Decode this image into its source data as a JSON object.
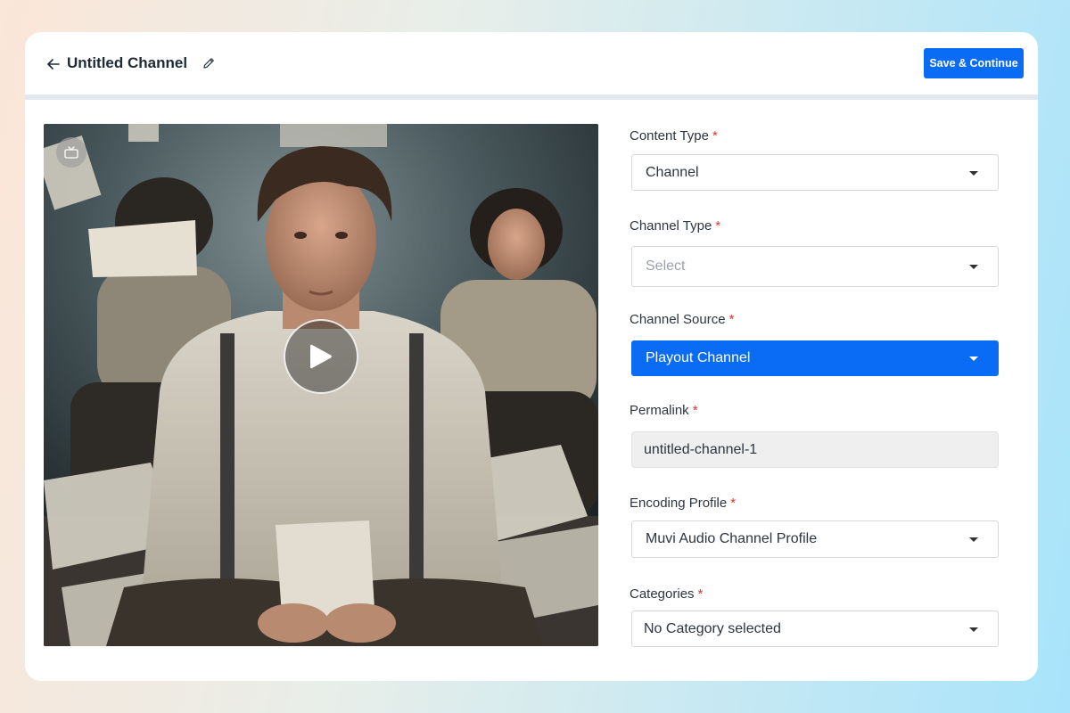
{
  "header": {
    "title": "Untitled Channel",
    "save_label": "Save & Continue",
    "icons": {
      "back": "arrow-left-icon",
      "edit": "pencil-icon"
    }
  },
  "media": {
    "badge_icon": "tv-icon",
    "play_icon": "play-icon"
  },
  "form": {
    "content_type": {
      "label": "Content Type",
      "required": "*",
      "value": "Channel"
    },
    "channel_type": {
      "label": "Channel Type",
      "required": "*",
      "placeholder": "Select"
    },
    "channel_source": {
      "label": "Channel Source",
      "required": "*",
      "value": "Playout Channel"
    },
    "permalink": {
      "label": "Permalink",
      "required": "*",
      "value": "untitled-channel-1"
    },
    "encoding_profile": {
      "label": "Encoding Profile",
      "required": "*",
      "value": "Muvi Audio Channel Profile"
    },
    "categories": {
      "label": "Categories",
      "required": "*",
      "value": "No Category selected"
    }
  },
  "colors": {
    "accent": "#0a6cf5",
    "required": "#e5322d",
    "text": "#2d3540"
  }
}
